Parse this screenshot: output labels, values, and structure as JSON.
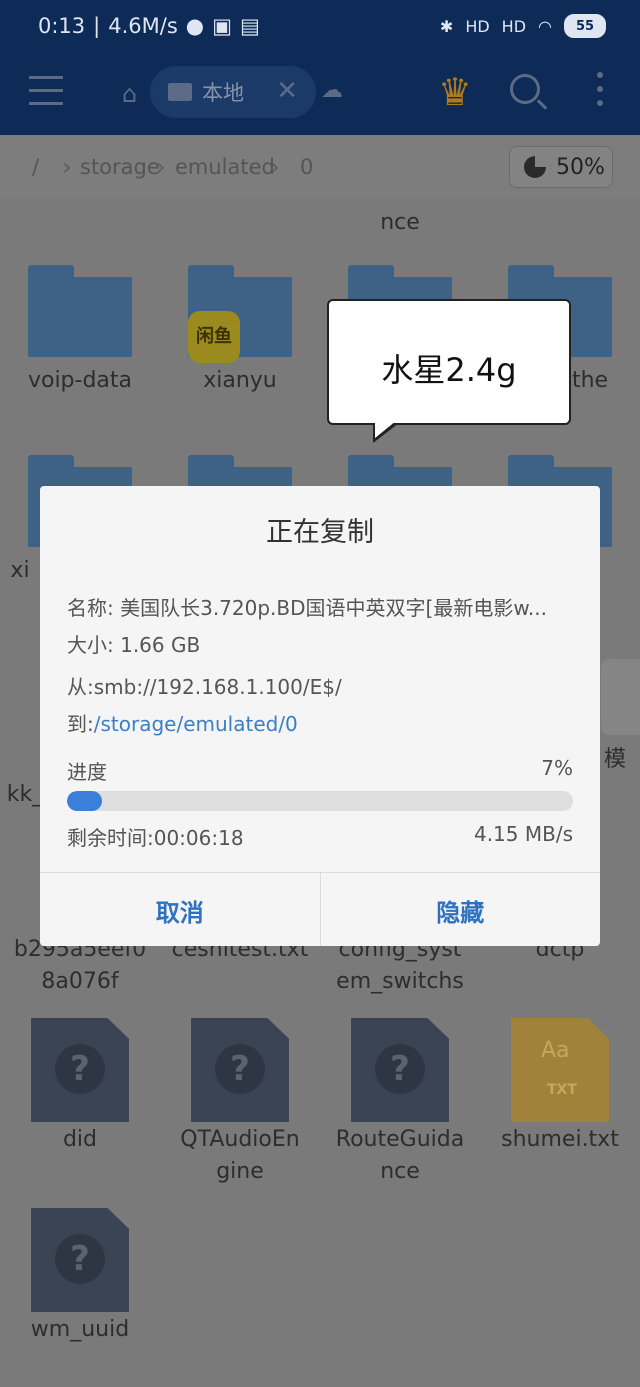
{
  "status_bar": {
    "time": "0:13",
    "speed": "4.6M/s",
    "signal1": "HD",
    "signal2": "HD",
    "battery": "55"
  },
  "app_bar": {
    "tab_label": "本地",
    "icons": [
      "menu-icon",
      "home-icon",
      "folder-tab-icon",
      "close-icon",
      "cloud-icon",
      "crown-icon",
      "search-icon",
      "more-icon"
    ]
  },
  "breadcrumb": {
    "root": "/",
    "items": [
      "storage",
      "emulated",
      "0"
    ],
    "usage": "50%"
  },
  "grid": {
    "partial_top": [
      "nce"
    ],
    "row1": [
      "voip-data",
      "xianyu",
      "",
      "the"
    ],
    "row2_partial": [
      "xi",
      "",
      "",
      ""
    ],
    "row3_partial": [
      "kk_",
      "",
      "",
      "模"
    ],
    "row4": [
      "b295a5eef0 8a076f",
      "ceshitest.txt",
      "config_syst em_switchs",
      "dctp"
    ],
    "row5": [
      "did",
      "QTAudioEn gine",
      "RouteGuida nce",
      "shumei.txt"
    ],
    "row6": [
      "wm_uuid"
    ],
    "xianyu_badge": "闲鱼",
    "txt_icon_top": "Aa",
    "txt_icon_bottom": "TXT"
  },
  "tooltip": {
    "text": "水星2.4g"
  },
  "dialog": {
    "title": "正在复制",
    "name_line": "名称: 美国队长3.720p.BD国语中英双字[最新电影w...",
    "size_line": "大小: 1.66 GB",
    "from_line": "从:smb://192.168.1.100/E$/",
    "to_prefix": "到:",
    "to_path": "/storage/emulated/0",
    "progress_label": "进度",
    "progress_percent": "7%",
    "progress_value": 0.07,
    "remaining": "剩余时间:00:06:18",
    "speed": "4.15 MB/s",
    "cancel_label": "取消",
    "hide_label": "隐藏"
  },
  "colors": {
    "app_bar": "#0e2a57",
    "accent": "#2f73c0",
    "progress_fill": "#3a7fd9"
  }
}
